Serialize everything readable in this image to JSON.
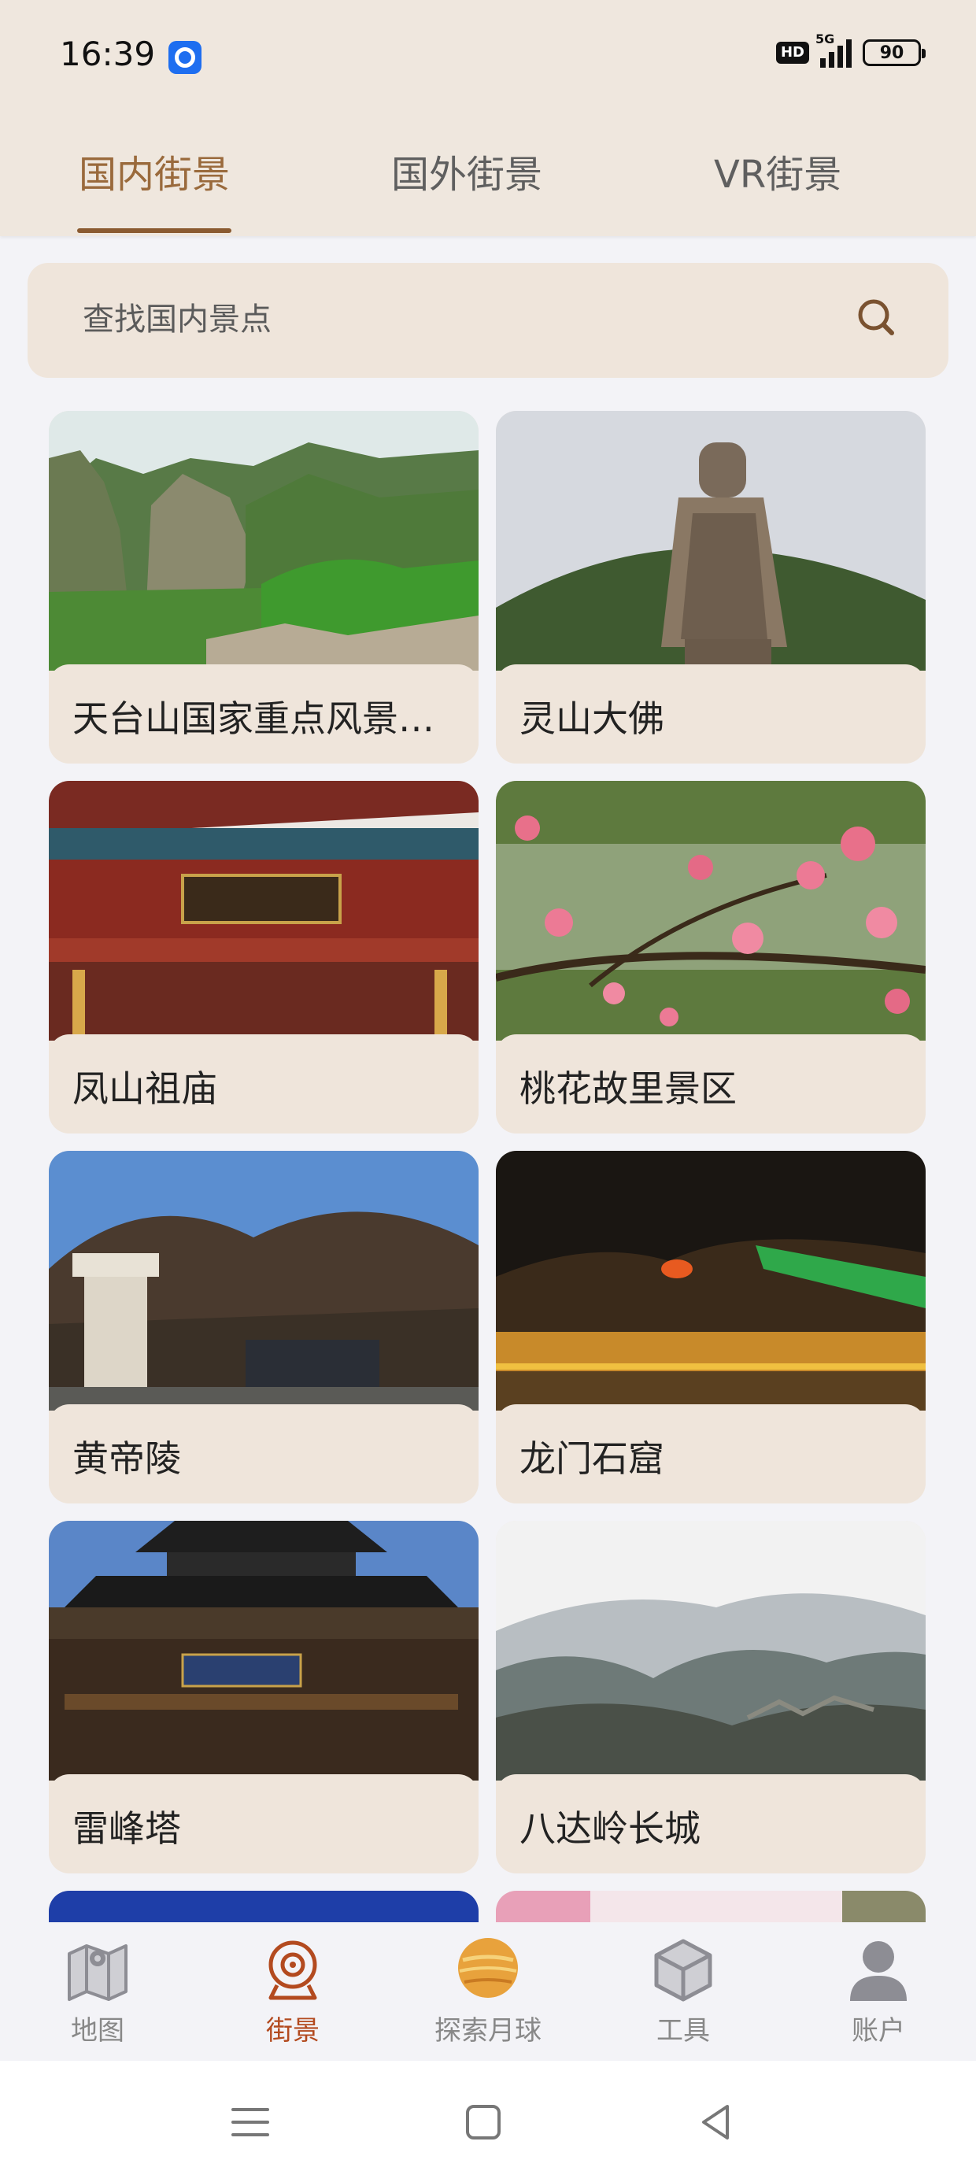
{
  "status_bar": {
    "time": "16:39",
    "hd": "HD",
    "network": "5G",
    "battery": "90"
  },
  "tabs": [
    {
      "label": "国内街景",
      "active": true
    },
    {
      "label": "国外街景",
      "active": false
    },
    {
      "label": "VR街景",
      "active": false
    }
  ],
  "search": {
    "placeholder": "查找国内景点",
    "value": ""
  },
  "places": [
    {
      "title": "天台山国家重点风景…"
    },
    {
      "title": "灵山大佛"
    },
    {
      "title": "凤山祖庙"
    },
    {
      "title": "桃花故里景区"
    },
    {
      "title": "黄帝陵"
    },
    {
      "title": "龙门石窟"
    },
    {
      "title": "雷峰塔"
    },
    {
      "title": "八达岭长城"
    }
  ],
  "bottom_nav": [
    {
      "label": "地图",
      "icon": "map-icon"
    },
    {
      "label": "街景",
      "icon": "street-view-icon",
      "active": true
    },
    {
      "label": "探索月球",
      "icon": "moon-icon"
    },
    {
      "label": "工具",
      "icon": "cube-icon"
    },
    {
      "label": "账户",
      "icon": "user-icon"
    }
  ],
  "colors": {
    "accent": "#9a6a3c",
    "active_nav": "#b34a1f",
    "header_bg": "#efe7de",
    "card_bg": "#efe5db"
  }
}
